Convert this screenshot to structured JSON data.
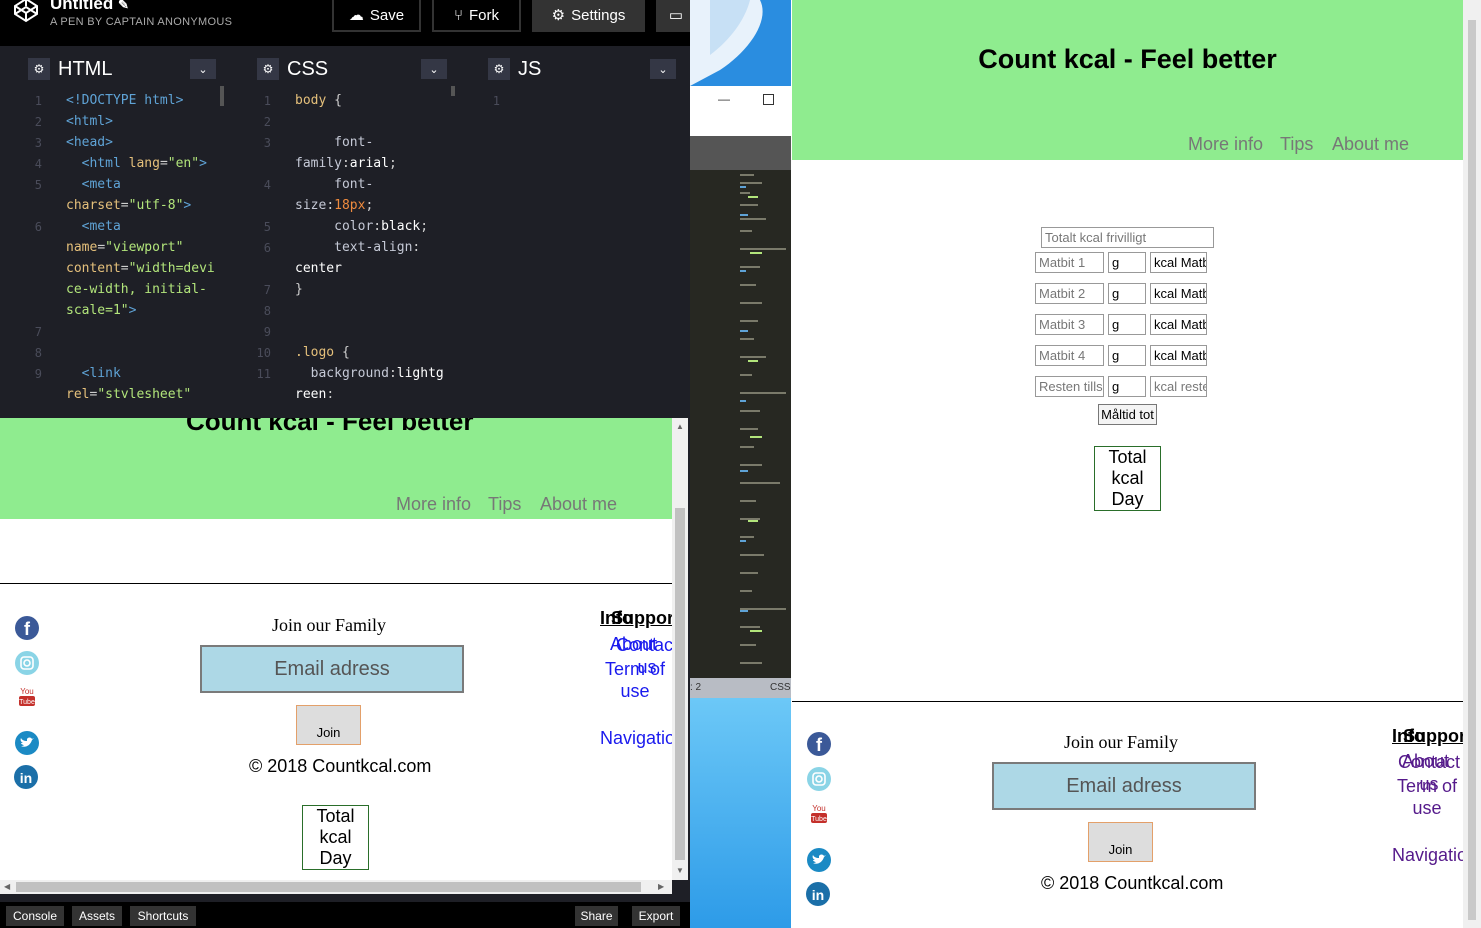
{
  "codepen": {
    "title": "Untitled",
    "subtitle": "A PEN BY CAPTAIN ANONYMOUS",
    "buttons": {
      "save": "Save",
      "fork": "Fork",
      "settings": "Settings"
    },
    "panes": {
      "html": "HTML",
      "css": "CSS",
      "js": "JS"
    },
    "footer": {
      "console": "Console",
      "assets": "Assets",
      "shortcuts": "Shortcuts",
      "share": "Share",
      "export": "Export"
    }
  },
  "editor_status": {
    "left": ": 2",
    "right": "CSS"
  },
  "site": {
    "heading": "Count kcal - Feel better",
    "nav": [
      "More info",
      "Tips",
      "About me"
    ],
    "form": {
      "total_placeholder": "Totalt kcal frivilligt",
      "rows": [
        {
          "food": "Matbit 1",
          "gram": "g",
          "kcal": "kcal Matbit"
        },
        {
          "food": "Matbit 2",
          "gram": "g",
          "kcal": "kcal Matbit"
        },
        {
          "food": "Matbit 3",
          "gram": "g",
          "kcal": "kcal Matbit"
        },
        {
          "food": "Matbit 4",
          "gram": "g",
          "kcal": "kcal Matbit"
        },
        {
          "food": "Resten tills",
          "gram": "g",
          "kcal": "kcal resten"
        }
      ],
      "meal_total": "Måltid tot",
      "total_day": [
        "Total",
        "kcal",
        "Day"
      ]
    },
    "footer": {
      "join_text": "Join our Family",
      "email_placeholder": "Email adress",
      "join_button": "Join",
      "copyright": "© 2018 Countkcal.com",
      "col_heading_a": "Info",
      "col_heading_b": "Support",
      "link_about": "About",
      "link_contact": "Contact us",
      "link_terms": "Term of use",
      "link_navigation": "Navigation"
    }
  },
  "colors": {
    "header_green": "#8fec8f",
    "email_blue": "#add8e6",
    "link_blue": "#1a1aee",
    "link_purple": "#551a8b"
  }
}
